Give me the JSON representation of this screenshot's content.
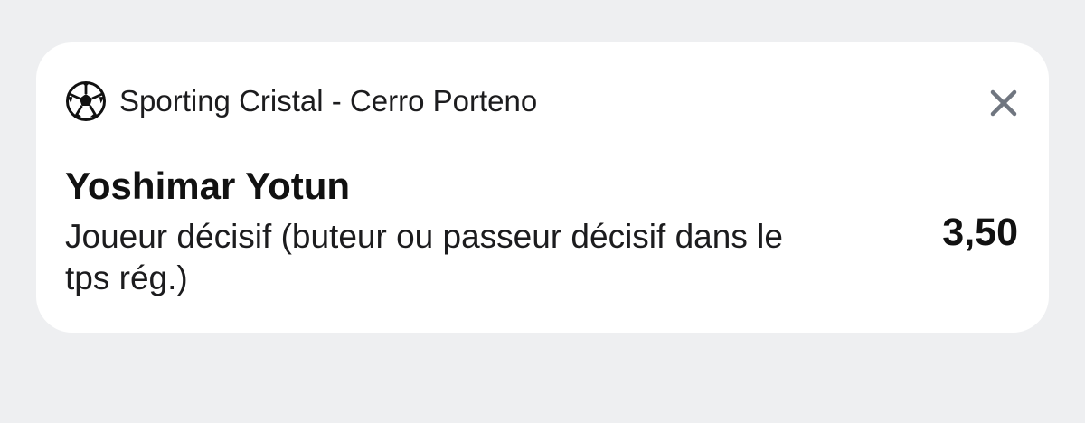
{
  "bet": {
    "sport_icon": "soccer-ball-icon",
    "match": "Sporting Cristal - Cerro Porteno",
    "close_icon": "close-icon",
    "selection": "Yoshimar Yotun",
    "market": "Joueur décisif (buteur ou passeur décisif dans le tps rég.)",
    "odds": "3,50"
  },
  "colors": {
    "background": "#eeeff1",
    "card": "#ffffff",
    "text": "#111111",
    "close_icon": "#707680"
  }
}
